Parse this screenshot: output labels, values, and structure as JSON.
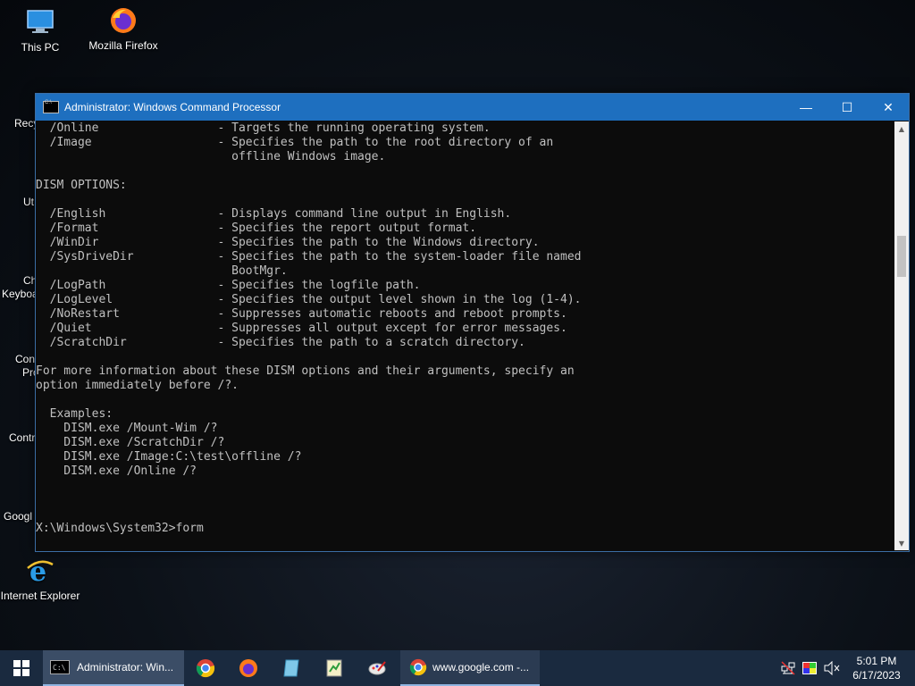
{
  "desktop": {
    "icons": [
      {
        "label": "This PC"
      },
      {
        "label": "Mozilla Firefox"
      },
      {
        "label": "Internet Explorer"
      }
    ],
    "partial_labels": [
      "Recy",
      "Ut",
      "Ch",
      "Keyboa",
      "Con",
      "Pro",
      "Contr",
      "Googl"
    ]
  },
  "window": {
    "title": "Administrator: Windows Command Processor",
    "minimize_glyph": "—",
    "maximize_glyph": "☐",
    "close_glyph": "✕"
  },
  "console": {
    "lines": [
      "  /Online                 - Targets the running operating system.",
      "  /Image                  - Specifies the path to the root directory of an",
      "                            offline Windows image.",
      "",
      "DISM OPTIONS:",
      "",
      "  /English                - Displays command line output in English.",
      "  /Format                 - Specifies the report output format.",
      "  /WinDir                 - Specifies the path to the Windows directory.",
      "  /SysDriveDir            - Specifies the path to the system-loader file named",
      "                            BootMgr.",
      "  /LogPath                - Specifies the logfile path.",
      "  /LogLevel               - Specifies the output level shown in the log (1-4).",
      "  /NoRestart              - Suppresses automatic reboots and reboot prompts.",
      "  /Quiet                  - Suppresses all output except for error messages.",
      "  /ScratchDir             - Specifies the path to a scratch directory.",
      "",
      "For more information about these DISM options and their arguments, specify an",
      "option immediately before /?.",
      "",
      "  Examples:",
      "    DISM.exe /Mount-Wim /?",
      "    DISM.exe /ScratchDir /?",
      "    DISM.exe /Image:C:\\test\\offline /?",
      "    DISM.exe /Online /?",
      "",
      "",
      "",
      "X:\\Windows\\System32>form"
    ]
  },
  "taskbar": {
    "cmd_task_label": "Administrator: Win...",
    "chrome_task_label": "www.google.com -...",
    "clock_time": "5:01 PM",
    "clock_date": "6/17/2023"
  },
  "colors": {
    "titlebar": "#1e6fbf",
    "console_bg": "#0c0c0c",
    "console_text": "#c0c0c0",
    "taskbar": "#1a2a3f"
  }
}
